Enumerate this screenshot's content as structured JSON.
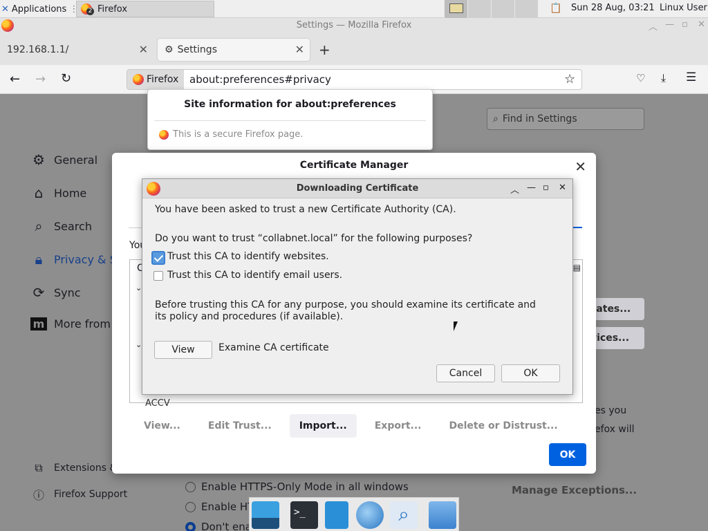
{
  "panel": {
    "applications_label": "Applications",
    "task_title": "Firefox",
    "task_badge": "2",
    "clock": "Sun 28 Aug, 03:21",
    "user": "Linux User"
  },
  "window": {
    "title": "Settings — Mozilla Firefox"
  },
  "tabs": [
    {
      "label": "192.168.1.1/"
    },
    {
      "label": "Settings"
    }
  ],
  "urlbar": {
    "identity_label": "Firefox",
    "url": "about:preferences#privacy"
  },
  "siteinfo": {
    "title": "Site information for about:preferences",
    "message": "This is a secure Firefox page."
  },
  "settings": {
    "find_placeholder": "Find in Settings",
    "sidebar": [
      {
        "label": "General",
        "icon": "gear-icon"
      },
      {
        "label": "Home",
        "icon": "home-icon"
      },
      {
        "label": "Search",
        "icon": "search-icon"
      },
      {
        "label": "Privacy & S",
        "icon": "lock-icon"
      },
      {
        "label": "Sync",
        "icon": "sync-icon"
      },
      {
        "label": "More from",
        "icon": "mozilla-icon"
      }
    ],
    "footer": [
      {
        "label": "Extensions &",
        "icon": "puzzle-icon"
      },
      {
        "label": "Firefox Support",
        "icon": "help-icon"
      }
    ],
    "right_btn1": "cates...",
    "right_btn2": "vices...",
    "right_text1": "es you",
    "right_text2": "efox will",
    "https_opt1": "Enable HTTPS-Only Mode in all windows",
    "https_opt2": "Enable HT",
    "https_opt3": "Don't ena",
    "manage_exceptions": "Manage Exceptions..."
  },
  "certmgr": {
    "title": "Certificate Manager",
    "you_text": "You",
    "tree_col": "C",
    "last_row": "ACCV",
    "buttons": [
      "View...",
      "Edit Trust...",
      "Import...",
      "Export...",
      "Delete or Distrust..."
    ],
    "ok": "OK"
  },
  "dlcert": {
    "title": "Downloading Certificate",
    "line1": "You have been asked to trust a new Certificate Authority (CA).",
    "line2": "Do you want to trust “collabnet.local” for the following purposes?",
    "opt_websites": "Trust this CA to identify websites.",
    "opt_websites_checked": true,
    "opt_email": "Trust this CA to identify email users.",
    "opt_email_checked": false,
    "line3": "Before trusting this CA for any purpose, you should examine its certificate and its policy and procedures (if available).",
    "view_btn": "View",
    "view_desc": "Examine CA certificate",
    "cancel_btn": "Cancel",
    "ok_btn": "OK"
  }
}
